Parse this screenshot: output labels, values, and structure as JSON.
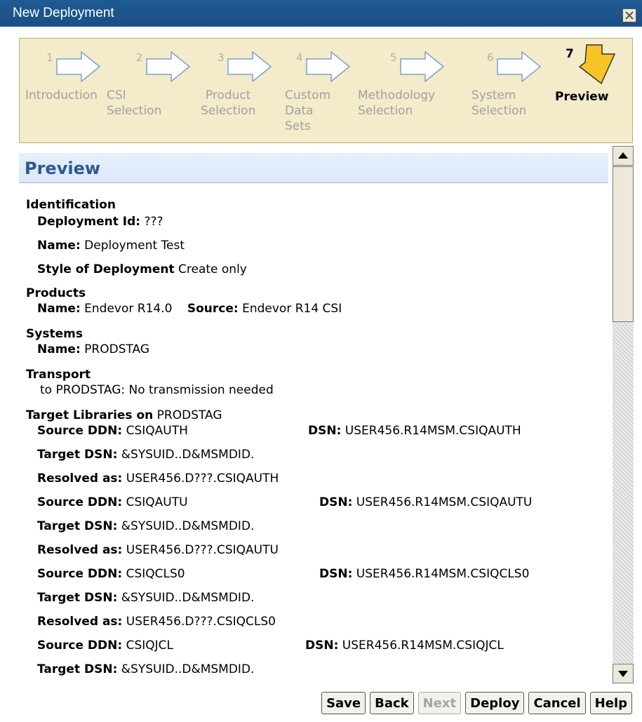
{
  "window": {
    "title": "New Deployment"
  },
  "wizard": {
    "steps": [
      {
        "num": "1",
        "label": "Introduction"
      },
      {
        "num": "2",
        "label": "CSI\nSelection"
      },
      {
        "num": "3",
        "label": "Product\nSelection"
      },
      {
        "num": "4",
        "label": "Custom\nData\nSets"
      },
      {
        "num": "5",
        "label": "Methodology\nSelection"
      },
      {
        "num": "6",
        "label": "System\nSelection"
      },
      {
        "num": "7",
        "label": "Preview"
      }
    ],
    "active_step": 7
  },
  "preview": {
    "heading": "Preview",
    "identification": {
      "title": "Identification",
      "id_label": "Deployment Id:",
      "id_value": "???",
      "name_label": "Name:",
      "name_value": "Deployment Test",
      "style_label": "Style of Deployment",
      "style_value": "Create only"
    },
    "products": {
      "title": "Products",
      "name_label": "Name:",
      "name_value": "Endevor R14.0",
      "source_label": "Source:",
      "source_value": "Endevor R14 CSI"
    },
    "systems": {
      "title": "Systems",
      "name_label": "Name:",
      "name_value": "PRODSTAG"
    },
    "transport": {
      "title": "Transport",
      "text": "to PRODSTAG: No transmission needed"
    },
    "targets": {
      "title": "Target Libraries on",
      "system": "PRODSTAG",
      "source_ddn_label": "Source DDN:",
      "dsn_label": "DSN:",
      "target_dsn_label": "Target DSN:",
      "resolved_label": "Resolved as:",
      "libs": [
        {
          "ddn": "CSIQAUTH",
          "dsn": "USER456.R14MSM.CSIQAUTH",
          "target": "&SYSUID..D&MSMDID.",
          "resolved": "USER456.D???.CSIQAUTH"
        },
        {
          "ddn": "CSIQAUTU",
          "dsn": "USER456.R14MSM.CSIQAUTU",
          "target": "&SYSUID..D&MSMDID.",
          "resolved": "USER456.D???.CSIQAUTU"
        },
        {
          "ddn": "CSIQCLS0",
          "dsn": "USER456.R14MSM.CSIQCLS0",
          "target": "&SYSUID..D&MSMDID.",
          "resolved": "USER456.D???.CSIQCLS0"
        },
        {
          "ddn": "CSIQJCL",
          "dsn": "USER456.R14MSM.CSIQJCL",
          "target": "&SYSUID..D&MSMDID."
        }
      ]
    }
  },
  "buttons": {
    "save": "Save",
    "back": "Back",
    "next": "Next",
    "deploy": "Deploy",
    "cancel": "Cancel",
    "help": "Help"
  },
  "colors": {
    "title_bar": "#1f5a92",
    "wizard_bg": "#f3ebca",
    "active_arrow": "#f7c325",
    "heading_text": "#2b5a8e"
  }
}
